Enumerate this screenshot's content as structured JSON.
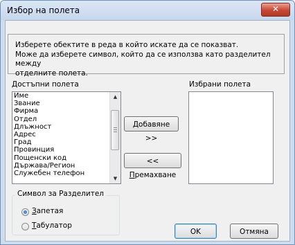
{
  "window": {
    "title": "Избор на полета",
    "close_label": "✕"
  },
  "info": {
    "line1": "Изберете обектите в реда в който искате да се показват.",
    "line2": "Може да изберете символ, който да се използва като разделител между",
    "line3": "отделните полета."
  },
  "available": {
    "label_u": "Д",
    "label_rest": "остъпни полета",
    "items": [
      "Име",
      "Звание",
      "Фирма",
      "Отдел",
      "Длъжност",
      "Адрес",
      "Град",
      "Провинция",
      "Пощенски код",
      "Държава/Регион",
      "Служебен телефон"
    ]
  },
  "selected": {
    "label": "Избрани полета",
    "items": []
  },
  "buttons": {
    "add_u": "Д",
    "add_rest": "обавяне >>",
    "remove_pre": "<< ",
    "remove_u": "П",
    "remove_rest": "ремахване",
    "ok": "OK",
    "cancel": "Отмяна"
  },
  "separator": {
    "title": "Символ за Разделител",
    "comma_u": "З",
    "comma_rest": "апетая",
    "tab_u": "Т",
    "tab_rest": "абулатор",
    "selected": "comma"
  }
}
